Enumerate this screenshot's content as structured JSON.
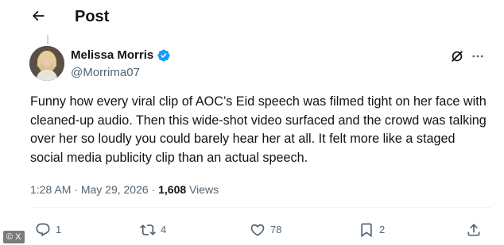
{
  "header": {
    "title": "Post",
    "back_icon": "arrow-left-icon"
  },
  "author": {
    "display_name": "Melissa Morris",
    "handle": "@Morrima07",
    "verified_color": "#1d9bf0"
  },
  "tweet": {
    "text": "Funny how every viral clip of AOC’s Eid speech was filmed tight on her face with cleaned-up audio. Then this wide-shot video surfaced and the crowd was talking over her so loudly you could barely hear her at all. It felt more like a staged social media publicity clip than an actual speech."
  },
  "meta": {
    "time": "1:28 AM",
    "separator1": " · ",
    "date": "May 29, 2026",
    "separator2": " · ",
    "views_count": "1,608",
    "views_label": " Views"
  },
  "actions": {
    "replies": "1",
    "reposts": "4",
    "likes": "78",
    "bookmarks": "2"
  },
  "watermark": "© X",
  "colors": {
    "text": "#0f1419",
    "muted": "#536471",
    "accent": "#1d9bf0",
    "divider": "#eff3f4"
  }
}
